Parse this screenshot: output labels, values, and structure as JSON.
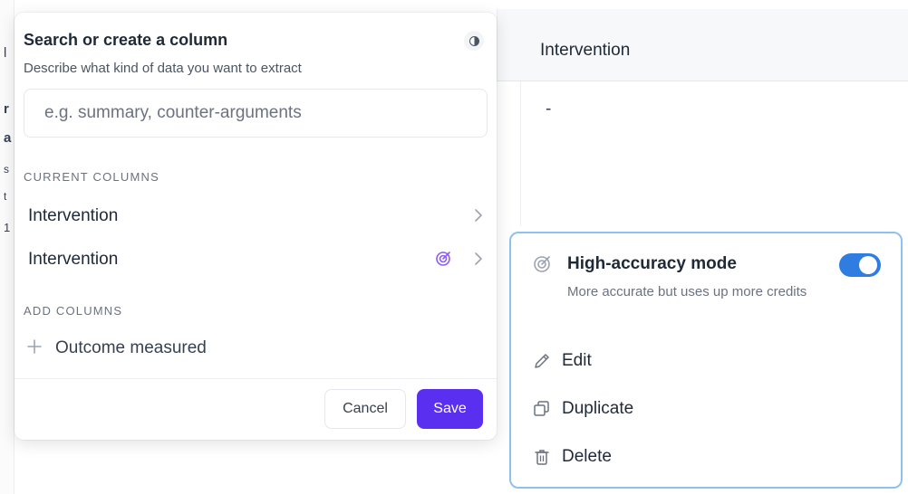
{
  "background": {
    "column_header": "Intervention",
    "cell_value": "-",
    "left_fragments": [
      "l",
      "r",
      "a",
      "s",
      "t",
      "1"
    ]
  },
  "popover": {
    "title": "Search or create a column",
    "subtitle": "Describe what kind of data you want to extract",
    "search_placeholder": "e.g. summary, counter-arguments",
    "search_value": "",
    "current_columns_label": "CURRENT COLUMNS",
    "current_columns": [
      {
        "label": "Intervention",
        "high_accuracy": false
      },
      {
        "label": "Intervention",
        "high_accuracy": true
      }
    ],
    "add_columns_label": "ADD COLUMNS",
    "add_columns": [
      {
        "label": "Outcome measured"
      }
    ],
    "cancel_label": "Cancel",
    "save_label": "Save"
  },
  "context_menu": {
    "high_accuracy": {
      "title": "High-accuracy mode",
      "description": "More accurate but uses up more credits",
      "enabled": true
    },
    "items": [
      {
        "label": "Edit",
        "icon": "pencil-icon"
      },
      {
        "label": "Duplicate",
        "icon": "duplicate-icon"
      },
      {
        "label": "Delete",
        "icon": "trash-icon"
      }
    ]
  },
  "colors": {
    "accent": "#5b2ff0",
    "toggle_on": "#2f7de1",
    "menu_border": "#8ec1f0",
    "target_icon": "#8b5cf6"
  }
}
